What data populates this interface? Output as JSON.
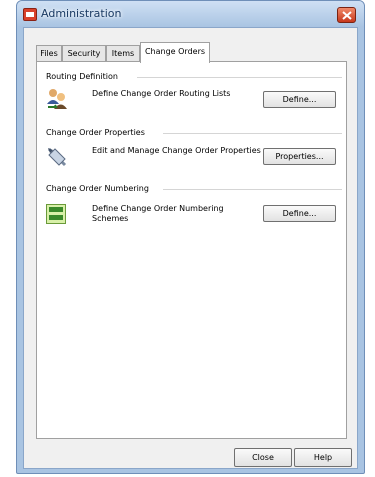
{
  "window": {
    "title": "Administration"
  },
  "tabs": [
    {
      "label": "Files"
    },
    {
      "label": "Security"
    },
    {
      "label": "Items"
    },
    {
      "label": "Change Orders"
    }
  ],
  "active_tab": "Change Orders",
  "sections": [
    {
      "heading": "Routing Definition",
      "description": "Define Change Order Routing Lists",
      "button": "Define...",
      "icon": "users-routing-icon"
    },
    {
      "heading": "Change Order Properties",
      "description": "Edit and Manage Change Order Properties",
      "button": "Properties...",
      "icon": "properties-tool-icon"
    },
    {
      "heading": "Change Order Numbering",
      "description": "Define Change Order Numbering Schemes",
      "button": "Define...",
      "icon": "numbering-scheme-icon"
    }
  ],
  "footer": {
    "close_label": "Close",
    "help_label": "Help"
  },
  "colors": {
    "title_bar": "#a9c4e2",
    "close_button": "#d9412b"
  }
}
